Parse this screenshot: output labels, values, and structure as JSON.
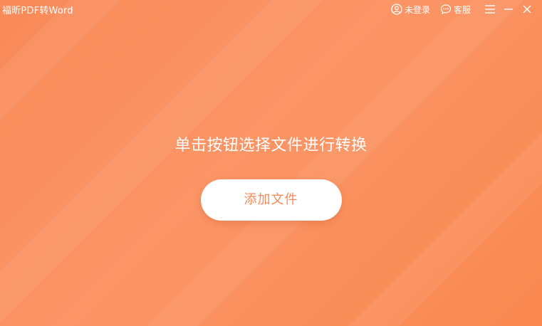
{
  "window": {
    "title": "福昕PDF转Word"
  },
  "titlebar": {
    "login_label": "未登录",
    "support_label": "客服",
    "icons": [
      "user-icon",
      "chat-icon",
      "menu-icon",
      "minimize-icon",
      "close-icon"
    ]
  },
  "main": {
    "prompt": "单击按钮选择文件进行转换",
    "add_button_label": "添加文件"
  },
  "colors": {
    "background": "#fa8a57",
    "accent_text": "#f48a58",
    "foreground": "#ffffff"
  }
}
